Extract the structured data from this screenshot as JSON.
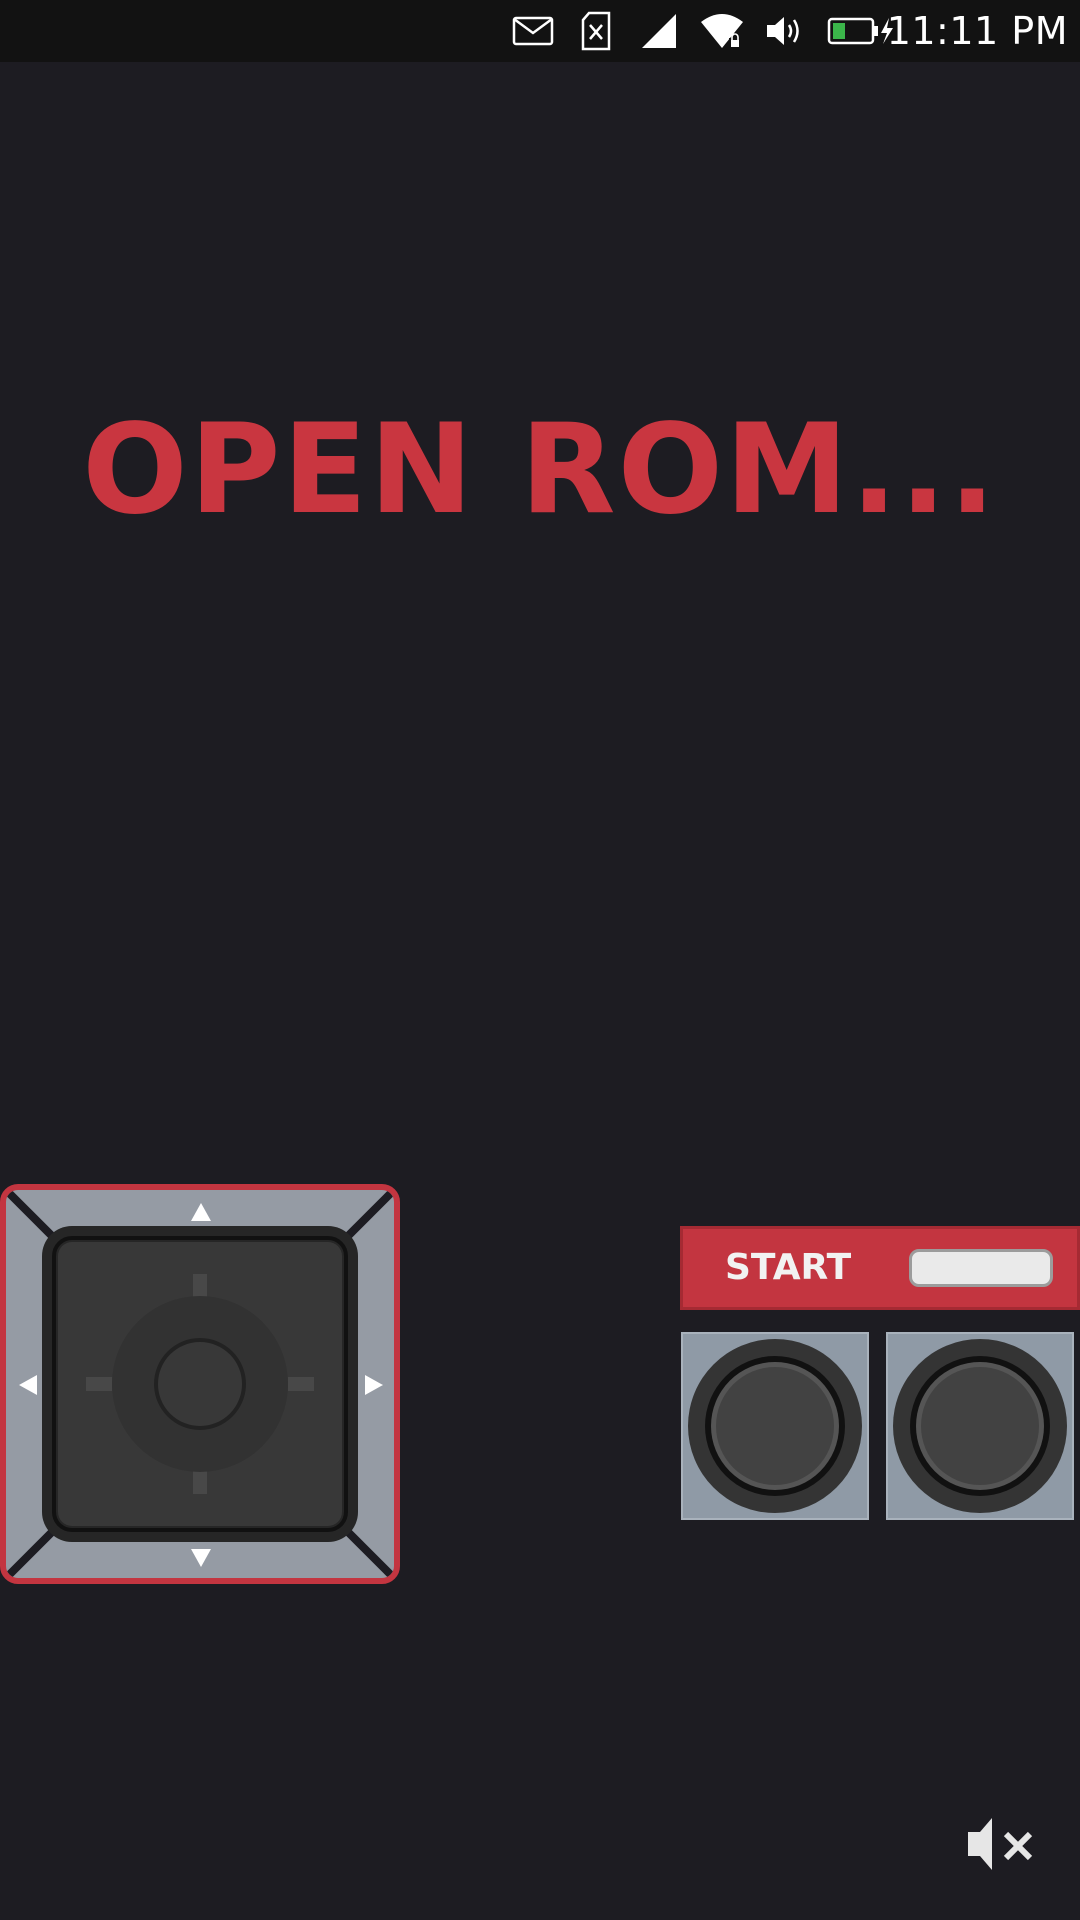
{
  "status_bar": {
    "time": "11:11 PM",
    "icons": [
      "email-icon",
      "sim-card-missing-icon",
      "cell-signal-icon",
      "wifi-locked-icon",
      "volume-icon",
      "battery-charging-icon"
    ]
  },
  "main": {
    "open_rom_label": "OPEN ROM..."
  },
  "controller": {
    "dpad_name": "dpad",
    "start_label": "START",
    "buttons": [
      "b-button",
      "a-button"
    ]
  },
  "colors": {
    "background": "#1d1c22",
    "accent_red": "#c93640",
    "pad_gray": "#959ba4",
    "button_dark": "#3a3a3a"
  },
  "footer": {
    "mute_icon": "volume-mute-icon"
  }
}
